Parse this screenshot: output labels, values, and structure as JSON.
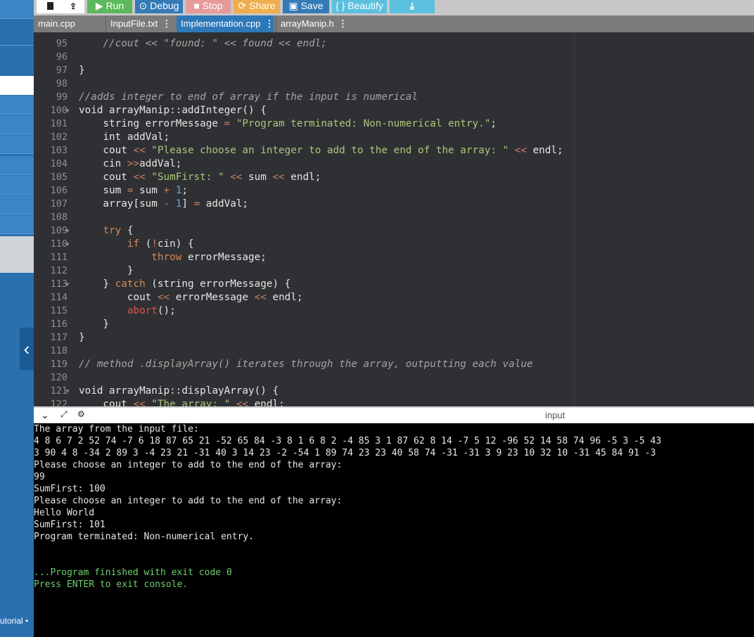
{
  "toolbar": {
    "run_label": "Run",
    "debug_label": "Debug",
    "stop_label": "Stop",
    "share_label": "Share",
    "save_label": "Save",
    "beautify_label": "{ } Beautify",
    "colors": {
      "run": "#5cb85c",
      "debug": "#337ab7",
      "stop": "#e69a9a",
      "share": "#f0ad4e",
      "save": "#337ab7",
      "beautify": "#5bc0de",
      "download": "#5bc0de"
    }
  },
  "tabs": [
    {
      "label": "main.cpp",
      "active": false
    },
    {
      "label": "InputFile.txt",
      "active": false
    },
    {
      "label": "Implementation.cpp",
      "active": true
    },
    {
      "label": "arrayManip.h",
      "active": false
    }
  ],
  "editor": {
    "lines": [
      {
        "n": "95",
        "html": "    <span class=\"cm\">//cout &lt;&lt; \"found: \" &lt;&lt; found &lt;&lt; endl;</span>"
      },
      {
        "n": "96",
        "html": ""
      },
      {
        "n": "97",
        "html": "}"
      },
      {
        "n": "98",
        "html": ""
      },
      {
        "n": "99",
        "html": "<span class=\"cm\">//adds integer to end of array if the input is numerical</span>"
      },
      {
        "n": "100",
        "fold": true,
        "html": "void arrayManip::addInteger() {"
      },
      {
        "n": "101",
        "html": "    string errorMessage <span class=\"op\">=</span> <span class=\"st\">\"Program terminated: Non-numerical entry.\"</span>;"
      },
      {
        "n": "102",
        "html": "    int addVal;"
      },
      {
        "n": "103",
        "html": "    cout <span class=\"op\">&lt;&lt;</span> <span class=\"st\">\"Please choose an integer to add to the end of the array: \"</span> <span class=\"op\">&lt;&lt;</span> endl;"
      },
      {
        "n": "104",
        "html": "    cin <span class=\"op\">&gt;&gt;</span>addVal;"
      },
      {
        "n": "105",
        "html": "    cout <span class=\"op\">&lt;&lt;</span> <span class=\"st\">\"SumFirst: \"</span> <span class=\"op\">&lt;&lt;</span> sum <span class=\"op\">&lt;&lt;</span> endl;"
      },
      {
        "n": "106",
        "html": "    sum <span class=\"op\">=</span> sum <span class=\"op\">+</span> <span class=\"nu\">1</span>;"
      },
      {
        "n": "107",
        "html": "    array[sum <span class=\"op\">-</span> <span class=\"nu\">1</span>] <span class=\"op\">=</span> addVal;"
      },
      {
        "n": "108",
        "html": ""
      },
      {
        "n": "109",
        "fold": true,
        "html": "    <span class=\"kw\">try</span> {"
      },
      {
        "n": "110",
        "fold": true,
        "html": "        <span class=\"kw\">if</span> (<span class=\"op\">!</span>cin) {"
      },
      {
        "n": "111",
        "html": "            <span class=\"kw\">throw</span> errorMessage;"
      },
      {
        "n": "112",
        "html": "        }"
      },
      {
        "n": "113",
        "fold": true,
        "html": "    } <span class=\"kw\">catch</span> (string errorMessage) {"
      },
      {
        "n": "114",
        "html": "        cout <span class=\"op\">&lt;&lt;</span> errorMessage <span class=\"op\">&lt;&lt;</span> endl;"
      },
      {
        "n": "115",
        "html": "        <span class=\"fn\">abort</span>();"
      },
      {
        "n": "116",
        "html": "    }"
      },
      {
        "n": "117",
        "html": "}"
      },
      {
        "n": "118",
        "html": ""
      },
      {
        "n": "119",
        "html": "<span class=\"cm\">// method .displayArray() iterates through the array, outputting each value</span>"
      },
      {
        "n": "120",
        "html": ""
      },
      {
        "n": "121",
        "fold": true,
        "html": "void arrayManip::displayArray() {"
      },
      {
        "n": "122",
        "html": "    cout <span class=\"op\">&lt;&lt;</span> <span class=\"st\">\"The array: \"</span> <span class=\"op\">&lt;&lt;</span> endl;"
      }
    ]
  },
  "console": {
    "input_label": "input",
    "lines": [
      {
        "text": "The array from the input file:"
      },
      {
        "text": "4 8 6 7 2 52 74 -7 6 18 87 65 21 -52 65 84 -3 8 1 6 8 2 -4 85 3 1 87 62 8 14 -7 5 12 -96 52 14 58 74 96 -5 3 -5 43"
      },
      {
        "text": "3 90 4 8 -34 2 89 3 -4 23 21 -31 40 3 14 23 -2 -54 1 89 74 23 23 40 58 74 -31 -31 3 9 23 10 32 10 -31 45 84 91 -3"
      },
      {
        "text": "Please choose an integer to add to the end of the array:"
      },
      {
        "text": "99"
      },
      {
        "text": "SumFirst: 100"
      },
      {
        "text": "Please choose an integer to add to the end of the array:"
      },
      {
        "text": "Hello World"
      },
      {
        "text": "SumFirst: 101"
      },
      {
        "text": "Program terminated: Non-numerical entry."
      },
      {
        "text": ""
      },
      {
        "text": ""
      },
      {
        "text": "...Program finished with exit code 0",
        "green": true
      },
      {
        "text": "Press ENTER to exit console.",
        "green": true
      }
    ]
  },
  "sidebar": {
    "footer_text": "utorial •"
  }
}
